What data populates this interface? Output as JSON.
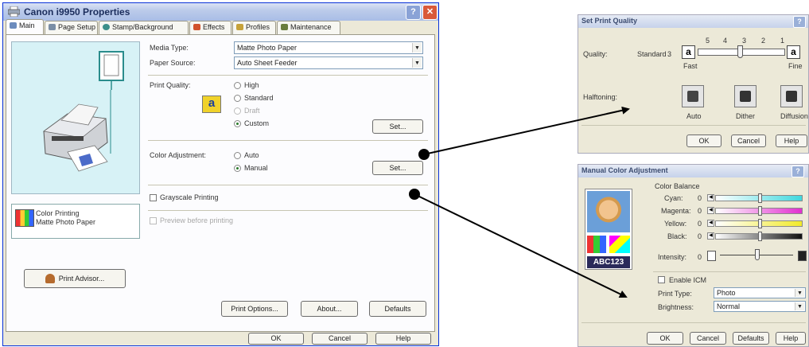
{
  "main_dialog": {
    "title": "Canon i9950 Properties",
    "tabs": [
      {
        "label": "Main"
      },
      {
        "label": "Page Setup"
      },
      {
        "label": "Stamp/Background"
      },
      {
        "label": "Effects"
      },
      {
        "label": "Profiles"
      },
      {
        "label": "Maintenance"
      }
    ],
    "media_type_label": "Media Type:",
    "media_type_value": "Matte Photo Paper",
    "paper_source_label": "Paper Source:",
    "paper_source_value": "Auto Sheet Feeder",
    "print_quality_label": "Print Quality:",
    "quality_options": [
      "High",
      "Standard",
      "Draft",
      "Custom"
    ],
    "quality_selected": "Custom",
    "set_label": "Set...",
    "color_adjustment_label": "Color Adjustment:",
    "color_options": [
      "Auto",
      "Manual"
    ],
    "color_selected": "Manual",
    "grayscale_label": "Grayscale Printing",
    "preview_label": "Preview before printing",
    "status_line1": "Color Printing",
    "status_line2": "Matte Photo Paper",
    "print_advisor_label": "Print Advisor...",
    "print_options_label": "Print Options...",
    "about_label": "About...",
    "defaults_label": "Defaults",
    "ok_label": "OK",
    "cancel_label": "Cancel",
    "help_label": "Help"
  },
  "quality_dialog": {
    "title": "Set Print Quality",
    "scale_numbers": [
      "5",
      "4",
      "3",
      "2",
      "1"
    ],
    "quality_label": "Quality:",
    "standard_label": "Standard",
    "standard_value": "3",
    "fast_label": "Fast",
    "fine_label": "Fine",
    "halftoning_label": "Halftoning:",
    "halftone_options": [
      "Auto",
      "Dither",
      "Diffusion"
    ],
    "ok_label": "OK",
    "cancel_label": "Cancel",
    "help_label": "Help"
  },
  "color_dialog": {
    "title": "Manual Color Adjustment",
    "balance_label": "Color Balance",
    "channels": [
      {
        "label": "Cyan:",
        "value": "0",
        "color": "#3fd8de"
      },
      {
        "label": "Magenta:",
        "value": "0",
        "color": "#e22fd0"
      },
      {
        "label": "Yellow:",
        "value": "0",
        "color": "#f2ea2a"
      },
      {
        "label": "Black:",
        "value": "0",
        "color": "#111111"
      }
    ],
    "intensity_label": "Intensity:",
    "intensity_value": "0",
    "sample_text": "ABC123",
    "enable_icm_label": "Enable ICM",
    "print_type_label": "Print Type:",
    "print_type_value": "Photo",
    "brightness_label": "Brightness:",
    "brightness_value": "Normal",
    "ok_label": "OK",
    "cancel_label": "Cancel",
    "defaults_label": "Defaults",
    "help_label": "Help"
  },
  "colors": {
    "title_blue": "#0831d9",
    "preview_cyan": "#d7f2f6",
    "close_red": "#d9593a"
  },
  "icons": [
    "printer-icon",
    "help-icon",
    "close-icon",
    "checkmark-icon",
    "arrow-icon"
  ]
}
